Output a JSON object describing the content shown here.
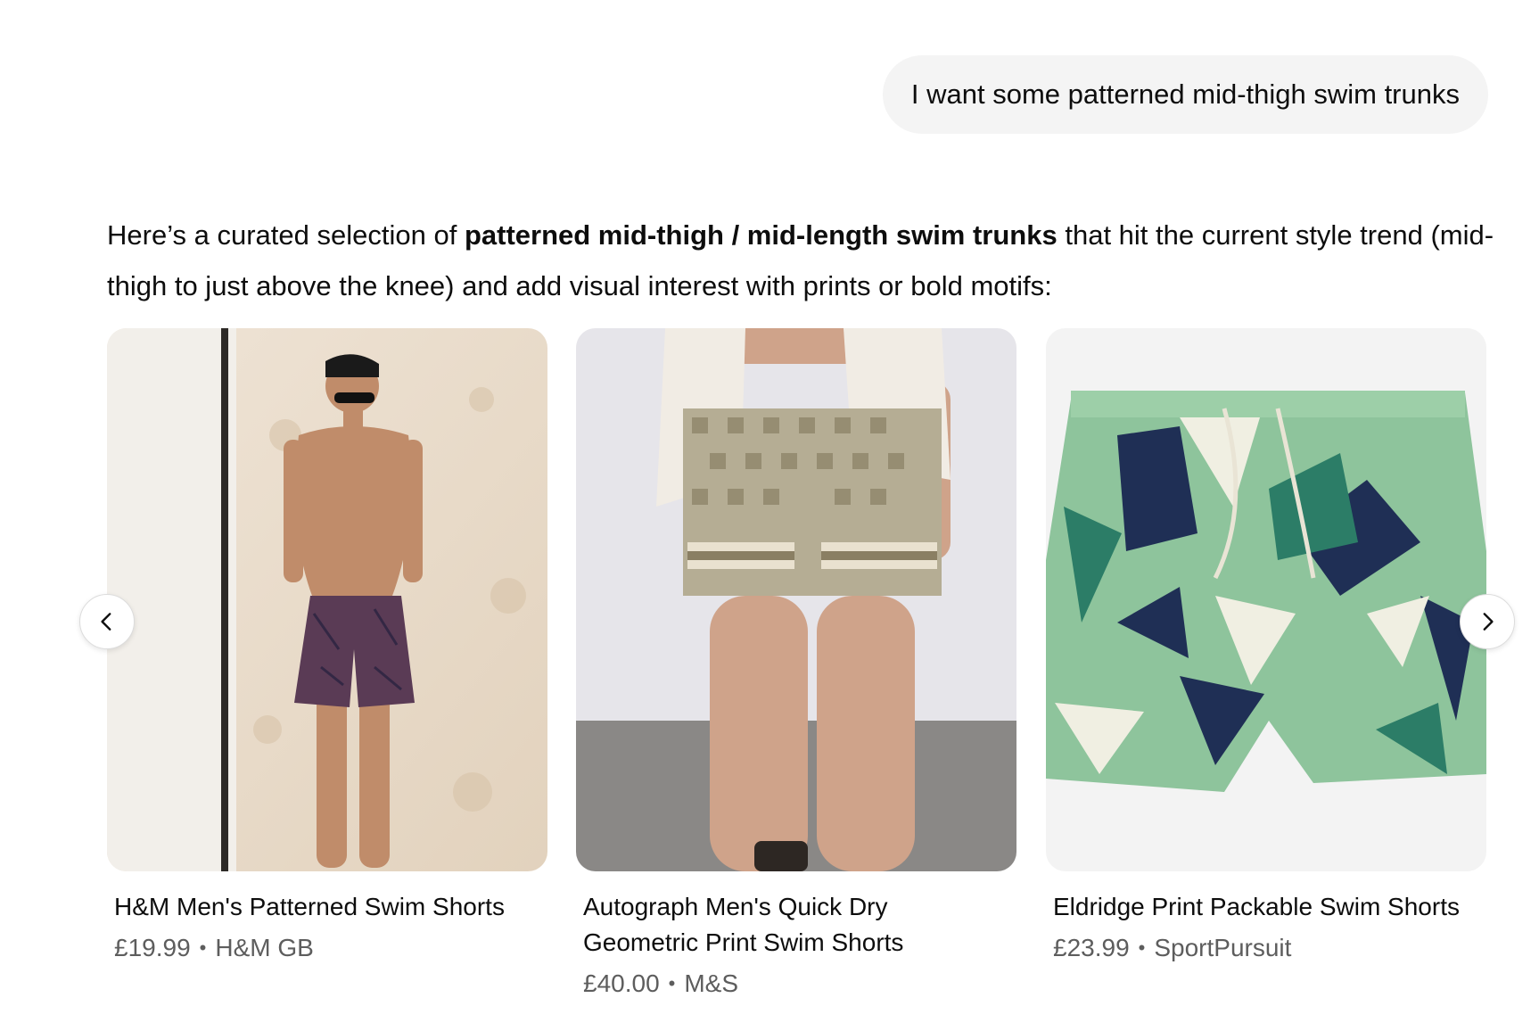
{
  "user_message": "I want some patterned mid-thigh swim trunks",
  "assistant": {
    "intro_before": "Here’s a curated selection of ",
    "intro_bold": "patterned mid-thigh / mid-length swim trunks",
    "intro_after": " that hit the current style trend (mid-thigh to just above the knee) and add visual interest with prints or bold motifs:"
  },
  "products": [
    {
      "title": "H&M Men's Patterned Swim Shorts",
      "price": "£19.99",
      "separator": "•",
      "store": "H&M GB",
      "image": "model-purple-palm-print-shorts"
    },
    {
      "title": "Autograph Men's Quick Dry Geometric Print Swim Shorts",
      "price": "£40.00",
      "separator": "•",
      "store": "M&S",
      "image": "model-khaki-geometric-print-shorts"
    },
    {
      "title": "Eldridge Print Packable Swim Shorts",
      "price": "£23.99",
      "separator": "•",
      "store": "SportPursuit",
      "image": "green-navy-geometric-print-shorts"
    }
  ],
  "carousel": {
    "prev_icon": "chevron-left-icon",
    "next_icon": "chevron-right-icon"
  },
  "colors": {
    "bubble_bg": "#f4f4f4",
    "text": "#0d0d0d",
    "meta_text": "#5d5d5d"
  }
}
